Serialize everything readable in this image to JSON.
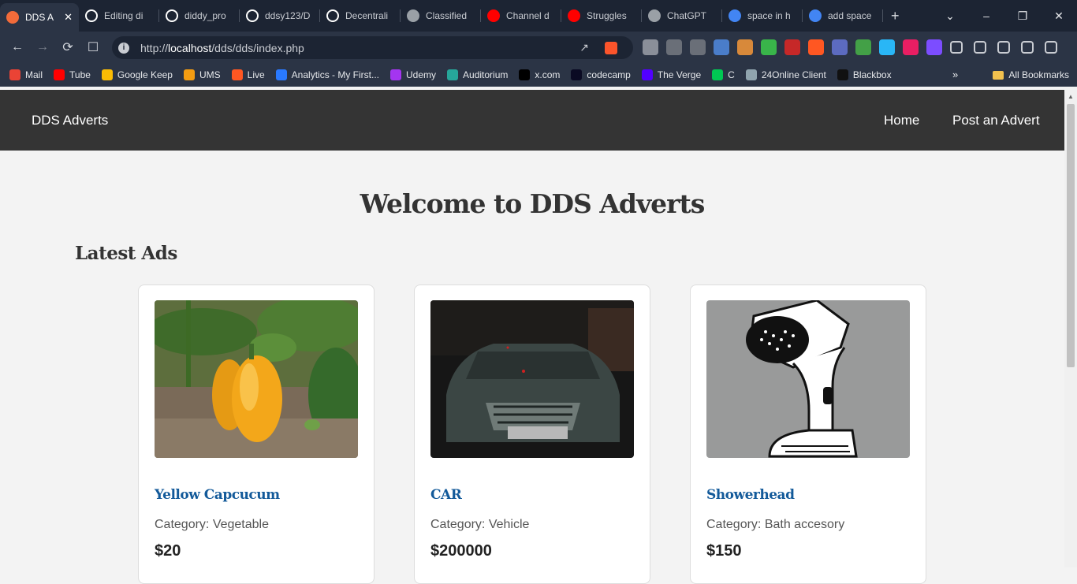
{
  "browser": {
    "tabs": [
      {
        "title": "DDS A",
        "active": true,
        "favicon": "dds-favicon",
        "color": "#f26b3a"
      },
      {
        "title": "Editing di",
        "favicon": "github-icon",
        "color": "#ffffff"
      },
      {
        "title": "diddy_pro",
        "favicon": "github-icon",
        "color": "#ffffff"
      },
      {
        "title": "ddsy123/D",
        "favicon": "github-icon",
        "color": "#ffffff"
      },
      {
        "title": "Decentrali",
        "favicon": "github-icon",
        "color": "#ffffff"
      },
      {
        "title": "Classified",
        "favicon": "chatgpt-icon",
        "color": "#9aa0a6"
      },
      {
        "title": "Channel d",
        "favicon": "youtube-icon",
        "color": "#ff0000"
      },
      {
        "title": "Struggles",
        "favicon": "youtube-icon",
        "color": "#ff0000"
      },
      {
        "title": "ChatGPT",
        "favicon": "chatgpt-icon",
        "color": "#9aa0a6"
      },
      {
        "title": "space in h",
        "favicon": "google-icon",
        "color": "#4285f4"
      },
      {
        "title": "add space",
        "favicon": "google-icon",
        "color": "#4285f4"
      }
    ],
    "url_prefix": "http://",
    "url_host": "localhost",
    "url_path": "/dds/dds/index.php",
    "bookmarks": [
      {
        "label": "Mail",
        "color": "#ea4335"
      },
      {
        "label": "Tube",
        "color": "#ff0000"
      },
      {
        "label": "Google Keep",
        "color": "#fbbc04"
      },
      {
        "label": "UMS",
        "color": "#f39c12"
      },
      {
        "label": "Live",
        "color": "#ff5722"
      },
      {
        "label": "Analytics - My First...",
        "color": "#2979ff"
      },
      {
        "label": "Udemy",
        "color": "#a435f0"
      },
      {
        "label": "Auditorium",
        "color": "#26a69a"
      },
      {
        "label": "x.com",
        "color": "#000000"
      },
      {
        "label": "codecamp",
        "color": "#0a0a23"
      },
      {
        "label": "The Verge",
        "color": "#5200ff"
      },
      {
        "label": "C",
        "color": "#00c853"
      },
      {
        "label": "24Online Client",
        "color": "#90a4ae"
      },
      {
        "label": "Blackbox",
        "color": "#111111"
      }
    ],
    "all_bookmarks": "All Bookmarks"
  },
  "site": {
    "brand": "DDS Adverts",
    "nav": [
      "Home",
      "Post an Advert"
    ],
    "heading": "Welcome to DDS Adverts",
    "subheading": "Latest Ads",
    "category_prefix": "Category: ",
    "ads": [
      {
        "title": "Yellow Capcucum",
        "category": "Vegetable",
        "price": "$20",
        "image": "pepper-photo"
      },
      {
        "title": "CAR",
        "category": "Vehicle",
        "price": "$200000",
        "image": "car-photo"
      },
      {
        "title": "Showerhead",
        "category": "Bath accesory",
        "price": "$150",
        "image": "showerhead-drawing"
      }
    ]
  }
}
